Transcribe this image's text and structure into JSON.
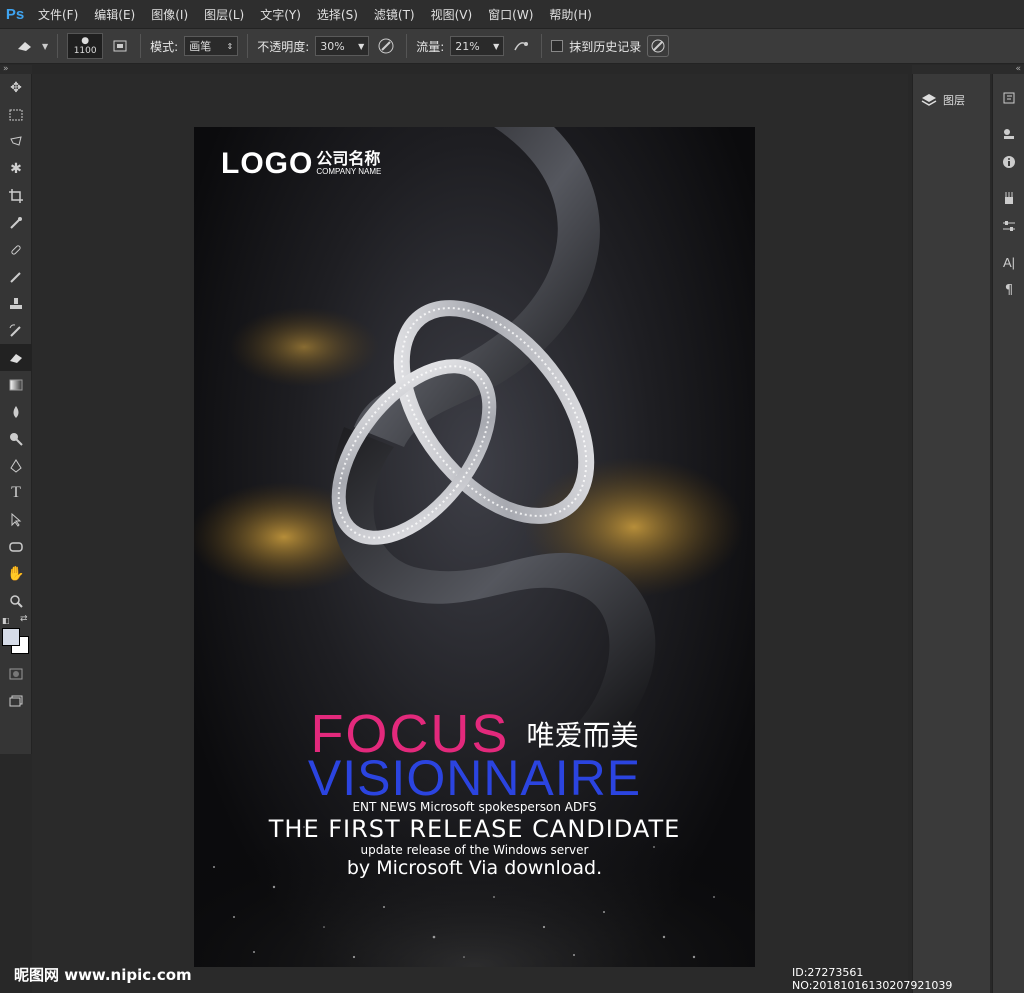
{
  "app": {
    "logo": "Ps"
  },
  "menu": [
    "文件(F)",
    "编辑(E)",
    "图像(I)",
    "图层(L)",
    "文字(Y)",
    "选择(S)",
    "滤镜(T)",
    "视图(V)",
    "窗口(W)",
    "帮助(H)"
  ],
  "options": {
    "brush_size": "1100",
    "mode_label": "模式:",
    "mode_value": "画笔",
    "opacity_label": "不透明度:",
    "opacity_value": "30%",
    "flow_label": "流量:",
    "flow_value": "21%",
    "history_label": "抹到历史记录"
  },
  "right_panel": {
    "layers_label": "图层"
  },
  "poster": {
    "logo_text": "LOGO",
    "company_cn": "公司名称",
    "company_en": "COMPANY NAME",
    "focus": "FOCUS",
    "focus_cn": "唯爱而美",
    "visionnaire": "VISIONNAIRE",
    "line1": "ENT NEWS Microsoft spokesperson ADFS",
    "line2": "THE FIRST RELEASE CANDIDATE",
    "line3": "update release of the Windows server",
    "line4": "by Microsoft Via download."
  },
  "watermark": {
    "left": "昵图网 www.nipic.com",
    "right": "ID:27273561 NO:20181016130207921039"
  },
  "colors": {
    "focus": "#e3297c",
    "visionnaire": "#2b44e0",
    "ps_blue": "#3fa4f0"
  }
}
